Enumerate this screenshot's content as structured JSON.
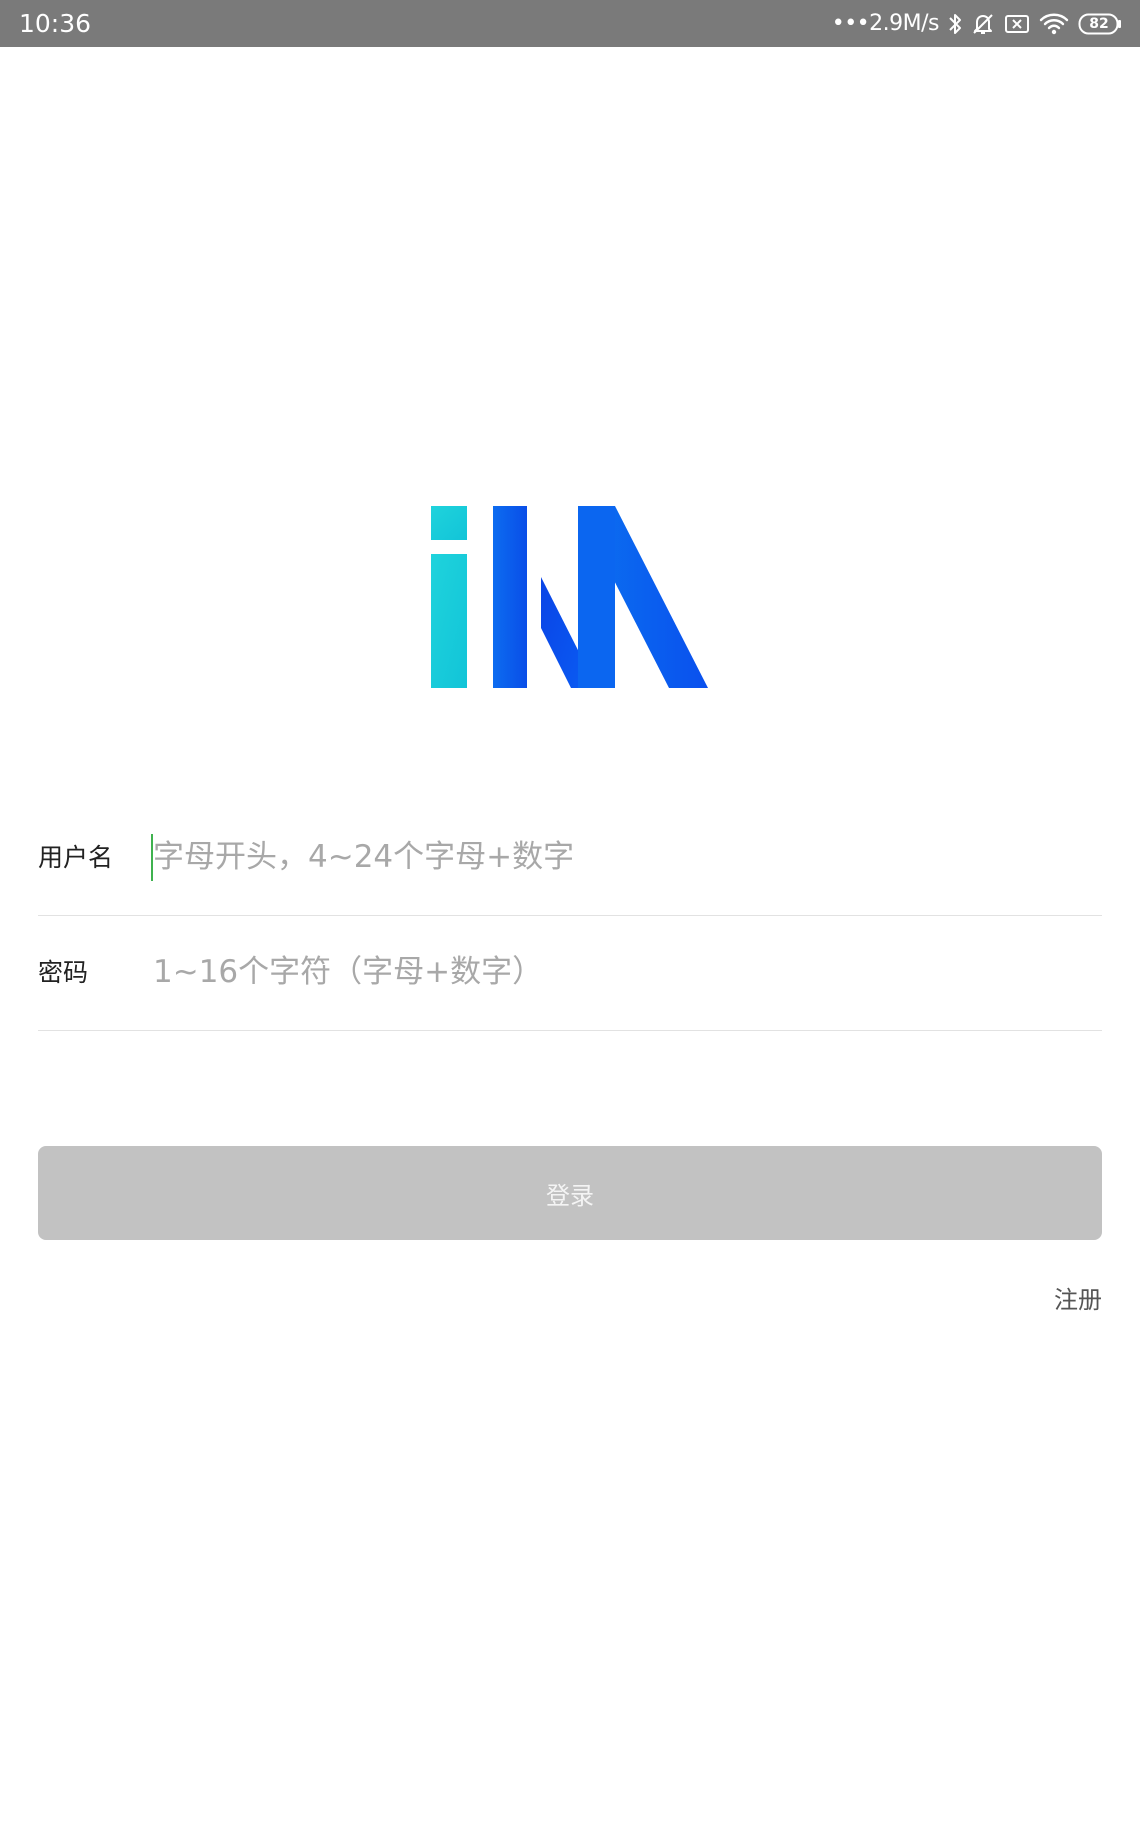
{
  "status_bar": {
    "time": "10:36",
    "network_speed": "•••2.9M/s",
    "battery_level": "82",
    "icons": [
      "bluetooth-icon",
      "bell-muted-icon",
      "sim-disabled-icon",
      "wifi-icon",
      "battery-icon"
    ]
  },
  "logo": {
    "text": "iM",
    "colors": {
      "cyan": "#1fd0dc",
      "blue": "#0a55f0",
      "deep_blue": "#0a3be6"
    }
  },
  "form": {
    "username": {
      "label": "用户名",
      "value": "",
      "placeholder": "字母开头，4~24个字母+数字"
    },
    "password": {
      "label": "密码",
      "value": "",
      "placeholder": "1~16个字符（字母+数字）"
    },
    "login_label": "登录",
    "register_label": "注册"
  },
  "colors": {
    "status_bar_bg": "#7a7a7a",
    "button_disabled_bg": "#c2c2c2",
    "caret": "#3fb24f",
    "divider": "#e2e2e2",
    "placeholder": "#a8a8a8"
  }
}
